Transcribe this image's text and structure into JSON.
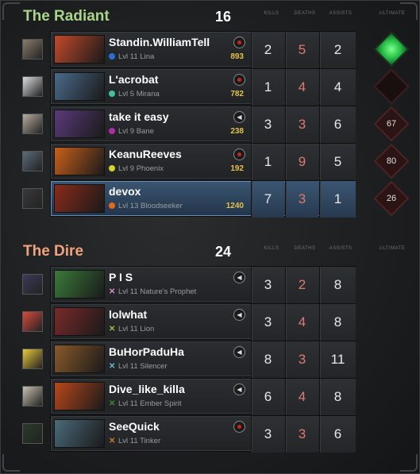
{
  "columns": {
    "kills": "KILLS",
    "deaths": "DEATHS",
    "assists": "ASSISTS",
    "ultimate": "ULTIMATE"
  },
  "radiant": {
    "name": "The Radiant",
    "score": "16",
    "players": [
      {
        "name": "Standin.WilliamTell",
        "level": "Lvl 11",
        "hero": "Lina",
        "gold": "893",
        "kills": "2",
        "deaths": "5",
        "assists": "2",
        "voice": "record",
        "ult": "ready",
        "ult_text": "",
        "dot_color": "#2a6fd6",
        "portrait": "#c24a2a",
        "avatar": "#8a7c6c"
      },
      {
        "name": "L'acrobat",
        "level": "Lvl 5",
        "hero": "Mirana",
        "gold": "782",
        "kills": "1",
        "deaths": "4",
        "assists": "4",
        "voice": "record",
        "ult": "empty",
        "ult_text": "",
        "dot_color": "#3fc1a2",
        "portrait": "#4a6a8a",
        "avatar": "#dcdcdc"
      },
      {
        "name": "take it easy",
        "level": "Lvl 9",
        "hero": "Bane",
        "gold": "238",
        "kills": "3",
        "deaths": "3",
        "assists": "6",
        "voice": "speaker",
        "ult": "cooldown",
        "ult_text": "67",
        "dot_color": "#b02aa6",
        "portrait": "#5a3a7a",
        "avatar": "#b8aca0"
      },
      {
        "name": "KeanuReeves",
        "level": "Lvl 9",
        "hero": "Phoenix",
        "gold": "192",
        "kills": "1",
        "deaths": "9",
        "assists": "5",
        "voice": "record",
        "ult": "cooldown",
        "ult_text": "80",
        "dot_color": "#d8d22a",
        "portrait": "#c8601a",
        "avatar": "#5a6a7a"
      },
      {
        "name": "devox",
        "level": "Lvl 13",
        "hero": "Bloodseeker",
        "gold": "1240",
        "kills": "7",
        "deaths": "3",
        "assists": "1",
        "voice": "none",
        "ult": "cooldown",
        "ult_text": "26",
        "dot_color": "#e06a1a",
        "portrait": "#8a2a1a",
        "avatar": "#3a3a3a",
        "selected": true
      }
    ]
  },
  "dire": {
    "name": "The Dire",
    "score": "24",
    "players": [
      {
        "name": "P I S",
        "level": "Lvl 11",
        "hero": "Nature's Prophet",
        "kills": "3",
        "deaths": "2",
        "assists": "8",
        "voice": "speaker",
        "x_color": "#d88ac8",
        "portrait": "#3a7a3a",
        "avatar": "#3a3a5a"
      },
      {
        "name": "lolwhat",
        "level": "Lvl 11",
        "hero": "Lion",
        "kills": "3",
        "deaths": "4",
        "assists": "8",
        "voice": "speaker",
        "x_color": "#a8b83a",
        "portrait": "#7a2a2a",
        "avatar": "#d84a3a"
      },
      {
        "name": "BuHorPaduHa",
        "level": "Lvl 11",
        "hero": "Silencer",
        "kills": "8",
        "deaths": "3",
        "assists": "11",
        "voice": "speaker",
        "x_color": "#6ab8d8",
        "portrait": "#8a5a2a",
        "avatar": "#e8c83a"
      },
      {
        "name": "Dive_like_killa",
        "level": "Lvl 11",
        "hero": "Ember Spirit",
        "kills": "6",
        "deaths": "4",
        "assists": "8",
        "voice": "speaker",
        "x_color": "#3a8a3a",
        "portrait": "#b8481a",
        "avatar": "#c8c0b0"
      },
      {
        "name": "SeeQuick",
        "level": "Lvl 11",
        "hero": "Tinker",
        "kills": "3",
        "deaths": "3",
        "assists": "6",
        "voice": "record",
        "x_color": "#c87a2a",
        "portrait": "#4a6a7a",
        "avatar": "#2a3a2a"
      }
    ]
  }
}
